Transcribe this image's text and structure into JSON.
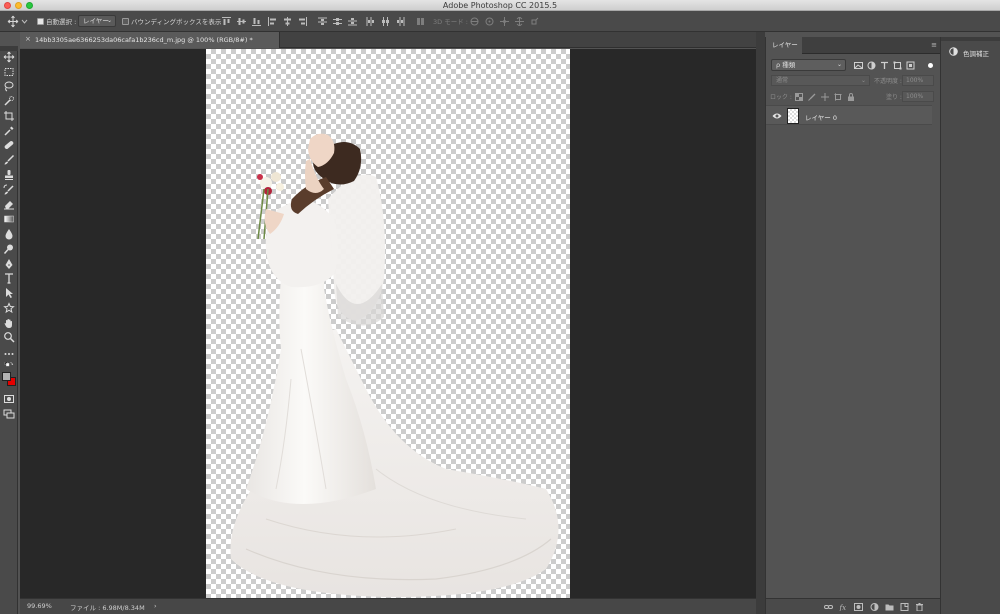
{
  "app": {
    "title": "Adobe Photoshop CC 2015.5"
  },
  "options_bar": {
    "auto_select_label": "自動選択 :",
    "auto_select_target": "レイヤー",
    "bounding_box_label": "バウンディングボックスを表示",
    "mode_3d_label": "3D モード :"
  },
  "document": {
    "tab_title": "14bb3305ae6366253da06cafa1b236cd_m.jpg @ 100% (RGB/8#) *",
    "close_glyph": "×"
  },
  "status": {
    "zoom": "99.69%",
    "file_info": "ファイル : 6.98M/8.34M",
    "arrow": "›"
  },
  "layers_panel": {
    "tab_label": "レイヤー",
    "filter_kind": "ρ 種類",
    "blend_mode": "通常",
    "opacity_label": "不透明度 :",
    "opacity_value": "100%",
    "lock_label": "ロック :",
    "fill_label": "塗り :",
    "fill_value": "100%",
    "layers": [
      {
        "name": "レイヤー 0",
        "visible": true
      }
    ]
  },
  "adjust_panel": {
    "label": "色調補正"
  },
  "colors": {
    "foreground": "#b2b2b2",
    "background": "#e40000"
  }
}
